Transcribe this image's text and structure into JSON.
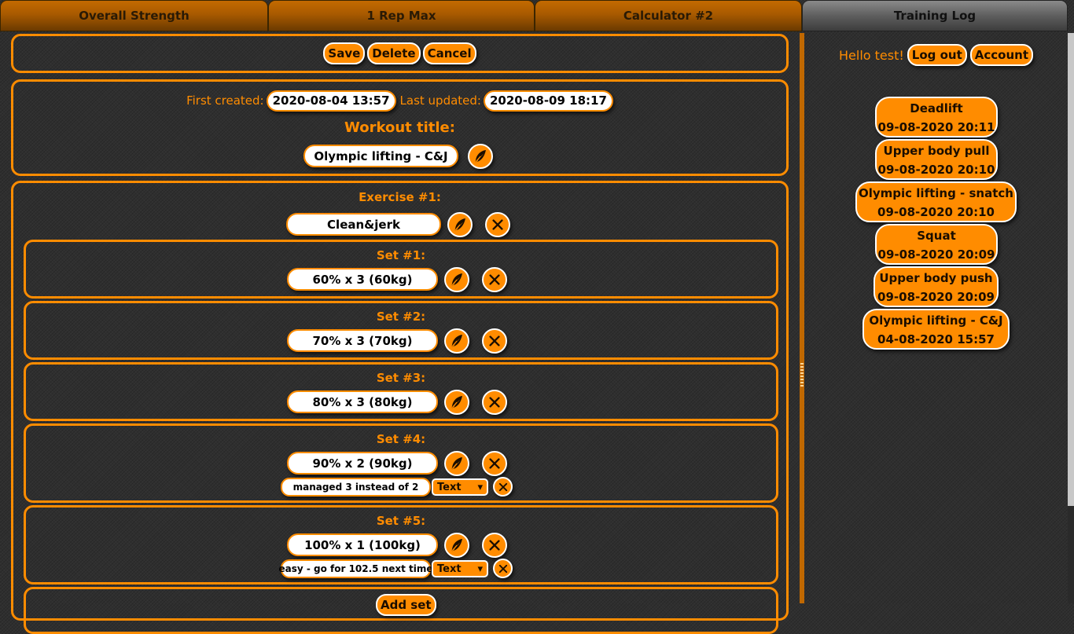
{
  "tabs": [
    {
      "label": "Overall Strength"
    },
    {
      "label": "1 Rep Max"
    },
    {
      "label": "Calculator #2"
    },
    {
      "label": "Training Log"
    }
  ],
  "toolbar": {
    "save": "Save",
    "delete": "Delete",
    "cancel": "Cancel"
  },
  "meta": {
    "first_created_label": "First created:",
    "first_created": "2020-08-04 13:57",
    "last_updated_label": "Last updated:",
    "last_updated": "2020-08-09 18:17",
    "title_label": "Workout title:",
    "title": "Olympic lifting - C&J"
  },
  "exercise": {
    "label": "Exercise #1:",
    "name": "Clean&jerk",
    "sets": [
      {
        "label": "Set #1:",
        "value": "60% x 3 (60kg)"
      },
      {
        "label": "Set #2:",
        "value": "70% x 3 (70kg)"
      },
      {
        "label": "Set #3:",
        "value": "80% x 3 (80kg)"
      },
      {
        "label": "Set #4:",
        "value": "90% x 2 (90kg)",
        "note": "managed 3 instead of 2",
        "note_type": "Text"
      },
      {
        "label": "Set #5:",
        "value": "100% x 1 (100kg)",
        "note": "easy - go for 102.5 next time",
        "note_type": "Text"
      }
    ],
    "add_set": "Add set"
  },
  "sidebar": {
    "greeting": "Hello test!",
    "logout": "Log out",
    "account": "Account",
    "log": [
      {
        "title": "Deadlift",
        "date": "09-08-2020 20:11"
      },
      {
        "title": "Upper body pull",
        "date": "09-08-2020 20:10"
      },
      {
        "title": "Olympic lifting - snatch",
        "date": "09-08-2020 20:10"
      },
      {
        "title": "Squat",
        "date": "09-08-2020 20:09"
      },
      {
        "title": "Upper body push",
        "date": "09-08-2020 20:09"
      },
      {
        "title": "Olympic lifting - C&J",
        "date": "04-08-2020 15:57"
      }
    ]
  },
  "icons": {
    "edit": "feather-icon",
    "remove": "close-icon",
    "dropdown": "chevron-down-icon"
  },
  "colors": {
    "accent": "#ff8c00",
    "background": "#2f2f2f",
    "field": "#ffffff"
  }
}
